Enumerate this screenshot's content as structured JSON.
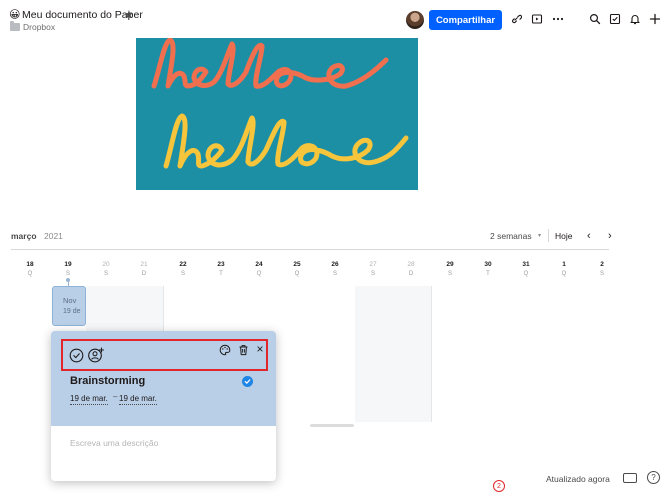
{
  "header": {
    "title": "Meu documento do Paper",
    "emoji": "😀",
    "star": "★",
    "folder": "Dropbox",
    "share_label": "Compartilhar",
    "icons": [
      "link-icon",
      "present-icon",
      "more-icon",
      "search-icon",
      "checklist-icon",
      "bell-icon",
      "plus-icon"
    ]
  },
  "hero_image": {
    "background": "#1d8fa5",
    "line1_color": "#ef6f4f",
    "line2_color": "#f6c53b"
  },
  "calendar": {
    "month": "março",
    "year": "2021",
    "range": "2 semanas",
    "range_caret": "▾",
    "today": "Hoje",
    "prev": "‹",
    "next": "›",
    "days": [
      {
        "num": "18",
        "wd": "Q",
        "weekend": false
      },
      {
        "num": "19",
        "wd": "S",
        "weekend": false
      },
      {
        "num": "20",
        "wd": "S",
        "weekend": true
      },
      {
        "num": "21",
        "wd": "D",
        "weekend": true
      },
      {
        "num": "22",
        "wd": "S",
        "weekend": false
      },
      {
        "num": "23",
        "wd": "T",
        "weekend": false
      },
      {
        "num": "24",
        "wd": "Q",
        "weekend": false
      },
      {
        "num": "25",
        "wd": "Q",
        "weekend": false
      },
      {
        "num": "26",
        "wd": "S",
        "weekend": false
      },
      {
        "num": "27",
        "wd": "S",
        "weekend": true
      },
      {
        "num": "28",
        "wd": "D",
        "weekend": true
      },
      {
        "num": "29",
        "wd": "S",
        "weekend": false
      },
      {
        "num": "30",
        "wd": "T",
        "weekend": false
      },
      {
        "num": "31",
        "wd": "Q",
        "weekend": false
      },
      {
        "num": "1",
        "wd": "Q",
        "weekend": false
      },
      {
        "num": "2",
        "wd": "S",
        "weekend": false
      }
    ],
    "event_chip": {
      "line1": "Nov",
      "line2": "19 de"
    }
  },
  "event_card": {
    "title": "Brainstorming",
    "start_date": "19 de mar.",
    "separator": "–",
    "end_date": "19 de mar.",
    "description_placeholder": "Escreva uma descrição",
    "close": "×",
    "accent": "#1f86e6",
    "highlight": "#e0262b"
  },
  "footer": {
    "status": "Atualizado agora",
    "notification_count": "2",
    "help": "?"
  }
}
